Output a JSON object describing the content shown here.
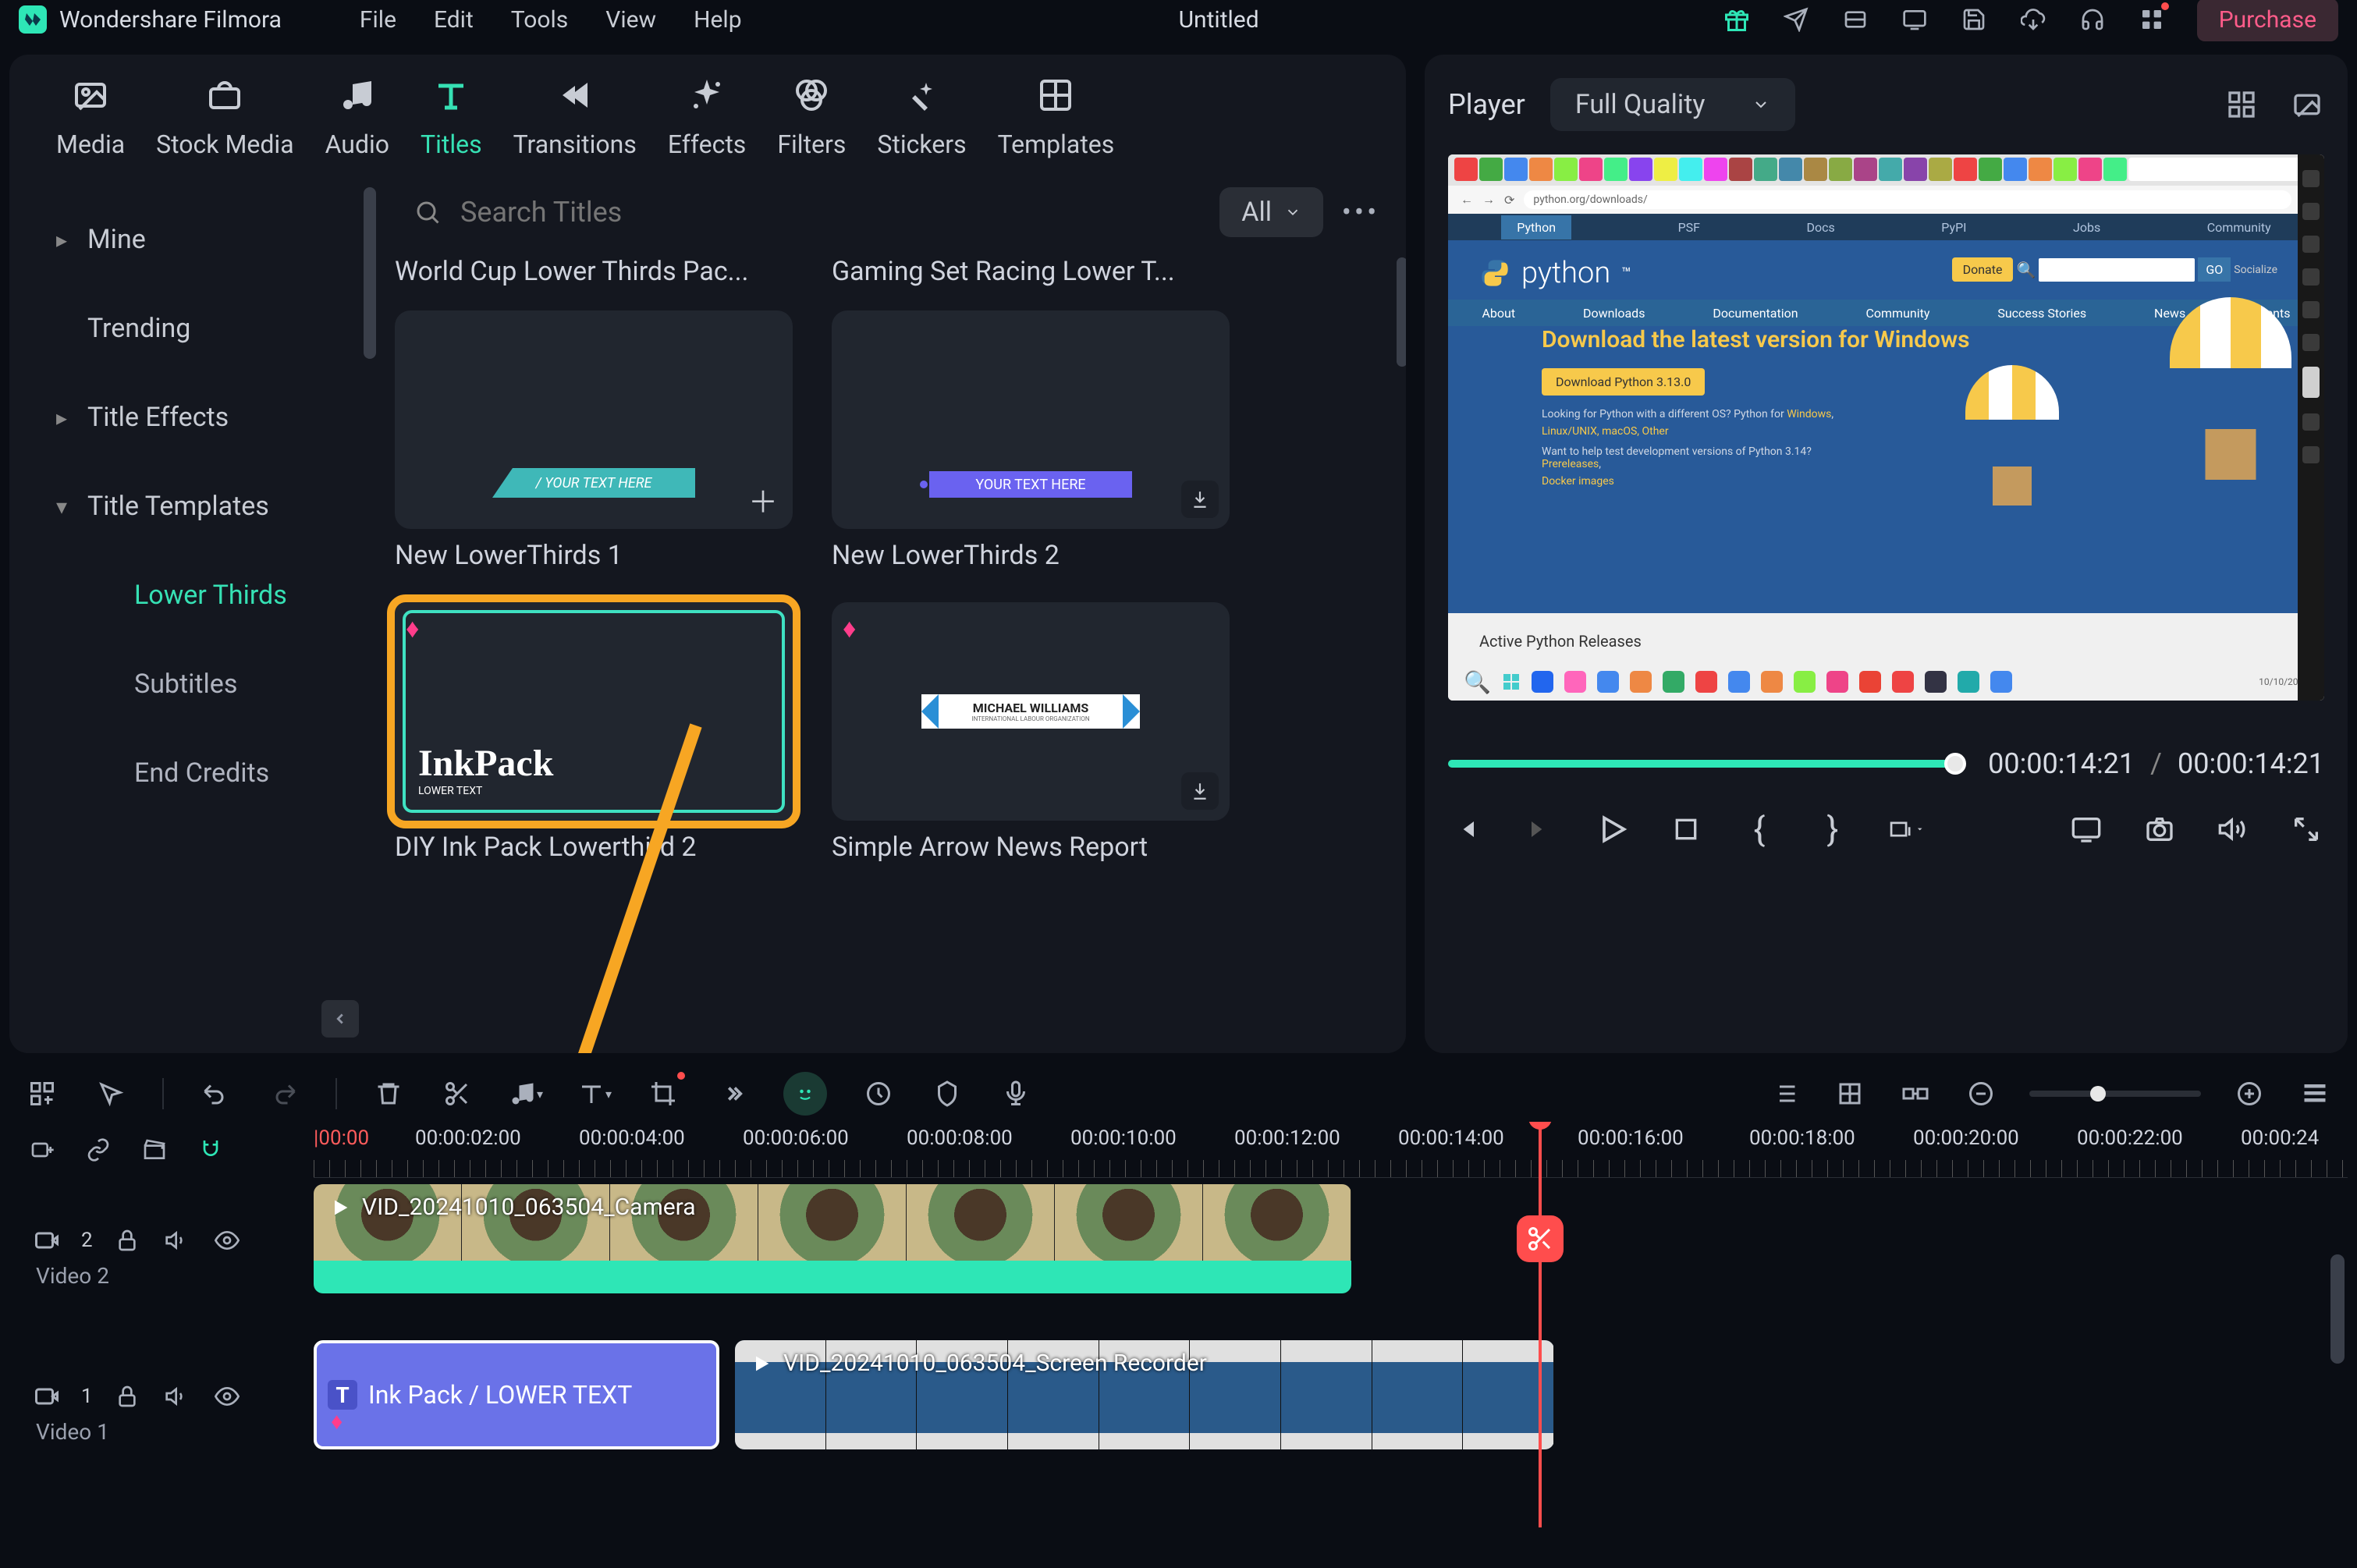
{
  "app": {
    "name": "Wondershare Filmora",
    "document": "Untitled"
  },
  "menu": [
    "File",
    "Edit",
    "Tools",
    "View",
    "Help"
  ],
  "titlebar_actions": {
    "purchase": "Purchase"
  },
  "asset_tabs": [
    {
      "id": "media",
      "label": "Media"
    },
    {
      "id": "stock",
      "label": "Stock Media"
    },
    {
      "id": "audio",
      "label": "Audio"
    },
    {
      "id": "titles",
      "label": "Titles"
    },
    {
      "id": "transitions",
      "label": "Transitions"
    },
    {
      "id": "effects",
      "label": "Effects"
    },
    {
      "id": "filters",
      "label": "Filters"
    },
    {
      "id": "stickers",
      "label": "Stickers"
    },
    {
      "id": "templates",
      "label": "Templates"
    }
  ],
  "sidebar": {
    "items": [
      {
        "label": "Mine",
        "expandable": true,
        "expanded": false
      },
      {
        "label": "Trending",
        "expandable": false
      },
      {
        "label": "Title Effects",
        "expandable": true,
        "expanded": false
      },
      {
        "label": "Title Templates",
        "expandable": true,
        "expanded": true
      }
    ],
    "subitems": [
      {
        "label": "Lower Thirds",
        "selected": true
      },
      {
        "label": "Subtitles",
        "selected": false
      },
      {
        "label": "End Credits",
        "selected": false
      }
    ]
  },
  "search": {
    "placeholder": "Search Titles",
    "filter_label": "All"
  },
  "packs": [
    "World Cup Lower Thirds Pac...",
    "Gaming Set Racing Lower T..."
  ],
  "thumbs": [
    {
      "caption": "New LowerThirds 1",
      "overlay_text": "/ YOUR TEXT HERE",
      "premium": false,
      "badge": "add"
    },
    {
      "caption": "New LowerThirds 2",
      "overlay_text": "YOUR TEXT HERE",
      "premium": false,
      "badge": "download"
    },
    {
      "caption": "DIY Ink Pack Lowerthird 2",
      "overlay_text": "InkPack",
      "overlay_sub": "LOWER TEXT",
      "premium": true,
      "selected": true
    },
    {
      "caption": "Simple Arrow News Report",
      "overlay_text": "MICHAEL WILLIAMS",
      "overlay_sub": "INTERNATIONAL LABOUR ORGANIZATION",
      "premium": true,
      "badge": "download"
    }
  ],
  "player": {
    "label": "Player",
    "quality": "Full Quality",
    "time_current": "00:00:14:21",
    "time_total": "00:00:14:21",
    "preview": {
      "url": "python.org/downloads/",
      "pynav": [
        "Python",
        "PSF",
        "Docs",
        "PyPI",
        "Jobs",
        "Community"
      ],
      "logo_text": "python",
      "donate": "Donate",
      "search_placeholder": "Search",
      "go": "GO",
      "social": "Socialize",
      "subnav": [
        "About",
        "Downloads",
        "Documentation",
        "Community",
        "Success Stories",
        "News",
        "Events"
      ],
      "hero_title": "Download the latest version for Windows",
      "dl_btn": "Download Python 3.13.0",
      "line1_a": "Looking for Python with a different OS? Python for ",
      "line1_b": "Windows",
      "line2": "Linux/UNIX, macOS, Other",
      "line3_a": "Want to help test development versions of Python 3.14? ",
      "line3_b": "Prereleases",
      "line4": "Docker images",
      "active_releases": "Active Python Releases"
    }
  },
  "timeline": {
    "ruler": [
      "|00:00",
      "00:00:02:00",
      "00:00:04:00",
      "00:00:06:00",
      "00:00:08:00",
      "00:00:10:00",
      "00:00:12:00",
      "00:00:14:00",
      "00:00:16:00",
      "00:00:18:00",
      "00:00:20:00",
      "00:00:22:00",
      "00:00:24"
    ],
    "tracks": [
      {
        "id": "video2",
        "label": "Video 2",
        "badge": "2"
      },
      {
        "id": "video1",
        "label": "Video 1",
        "badge": "1"
      }
    ],
    "clips": {
      "video2_clip": "VID_20241010_063504_Camera",
      "title_clip": "Ink Pack / LOWER TEXT",
      "screen_clip": "VID_20241010_063504_Screen Recorder"
    }
  }
}
